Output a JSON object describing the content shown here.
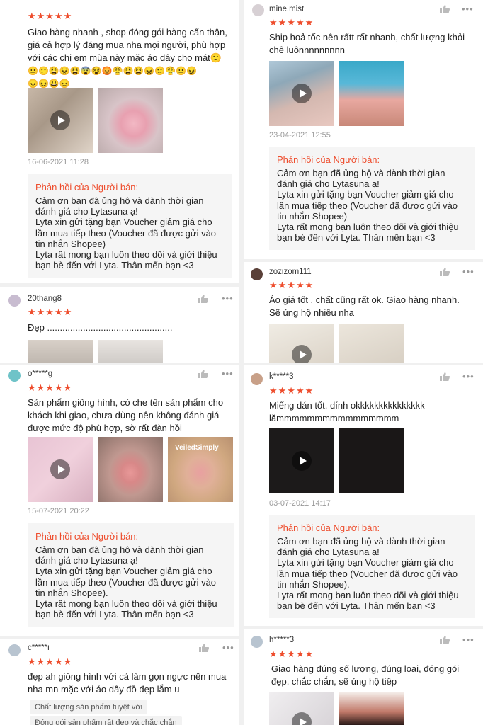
{
  "colors": {
    "star": "#ee4d2d",
    "seller_title": "#ee4d2d",
    "response_bg": "#f5f5f5"
  },
  "icons": {
    "like": "thumbs-up-icon",
    "more": "more-dots-icon",
    "play": "play-icon",
    "star": "star-icon"
  },
  "rating_stars": "★★★★★",
  "more_glyph": "•••",
  "seller_response_title": "Phản hồi của Người bán:",
  "reviews": [
    {
      "text_lines": [
        "Giao hàng nhanh , shop đóng gói hàng cẩn thận,",
        "giá cả hợp lý đáng mua nha mọi người, phù hợp",
        "với các chị em mùa này mặc áo dây cho mát🙂"
      ],
      "emoji_lines": [
        "😐😕😩😣😫😨😵😡😤😩😫😖🙁😤😐😖",
        "😠😖😃😖"
      ],
      "date": "16-06-2021 11:28",
      "response_lines": [
        "Cảm ơn bạn đã ủng hộ và dành thời gian",
        "đánh giá cho Lytasuna ạ!",
        "Lyta xin gửi tặng bạn Voucher giảm giá cho",
        "lần mua tiếp theo (Voucher đã được gửi vào",
        "tin nhắn Shopee)",
        "Lyta rất mong bạn luôn theo dõi và giới thiệu",
        "bạn bè đến với Lyta. Thân mến bạn <3"
      ]
    },
    {
      "username": "mine.mist",
      "text_lines": [
        "Ship hoả tốc nên rấtt rất nhanh, chất lượng khỏi",
        "chê luônnnnnnnnn"
      ],
      "date": "23-04-2021 12:55",
      "response_lines": [
        "Cảm ơn bạn đã ủng hộ và dành thời gian",
        "đánh giá cho Lytasuna ạ!",
        "Lyta xin gửi tặng bạn Voucher giảm giá cho",
        "lần mua tiếp theo (Voucher đã được gửi vào",
        "tin nhắn Shopee)",
        "Lyta rất mong bạn luôn theo dõi và giới thiệu",
        "bạn bè đến với Lyta. Thân mến bạn <3"
      ]
    },
    {
      "username": "20thang8",
      "text_lines": [
        "Đẹp ................................................."
      ]
    },
    {
      "username": "zozizom111",
      "text_lines": [
        "Áo giá tốt , chất cũng rất ok. Giao hàng nhanh.",
        "Sẽ ủng hộ nhiều nha"
      ]
    },
    {
      "username": "o*****g",
      "text_lines": [
        "Sản phẩm giống hình, có che tên sản phẩm cho",
        "khách khi giao, chưa dùng nên không đánh giá",
        "được mức độ phù hợp, sờ rất đàn hồi"
      ],
      "package_label": "VeiledSimply",
      "date": "15-07-2021 20:22",
      "response_lines": [
        "Cảm ơn bạn đã ủng hộ và dành thời gian",
        "đánh giá cho Lytasuna ạ!",
        "Lyta xin gửi tặng bạn Voucher giảm giá cho",
        "lần mua tiếp theo (Voucher đã được gửi vào",
        "tin nhắn Shopee).",
        "Lyta rất mong bạn luôn theo dõi và giới thiệu",
        "bạn bè đến với Lyta. Thân mến bạn <3"
      ]
    },
    {
      "username": "k*****3",
      "text_lines": [
        "Miếng dán tốt, dính okkkkkkkkkkkkkkk",
        "lămmmmmmmmmmmmmmmm"
      ],
      "date": "03-07-2021 14:17",
      "response_lines": [
        "Cảm ơn bạn đã ủng hộ và dành thời gian",
        "đánh giá cho Lytasuna ạ!",
        "Lyta xin gửi tặng bạn Voucher giảm giá cho",
        "lần mua tiếp theo (Voucher đã được gửi vào",
        "tin nhắn Shopee).",
        "Lyta rất mong bạn luôn theo dõi và giới thiệu",
        "bạn bè đến với Lyta. Thân mến bạn <3"
      ]
    },
    {
      "username": "c*****i",
      "text_lines": [
        "đẹp ah giống hình với cả làm gọn ngực nên mua",
        "nha mn mặc với áo dây đồ đẹp lắm u"
      ],
      "tags": [
        "Chất lượng sản phẩm tuyệt vời",
        "Đóng gói sản phẩm rất đẹp và chắc chắn"
      ]
    },
    {
      "username": "h*****3",
      "text_lines": [
        "Giao hàng đúng số lượng, đúng loại, đóng gói",
        "đẹp, chắc chắn, sẽ ủng hộ tiếp"
      ]
    }
  ]
}
